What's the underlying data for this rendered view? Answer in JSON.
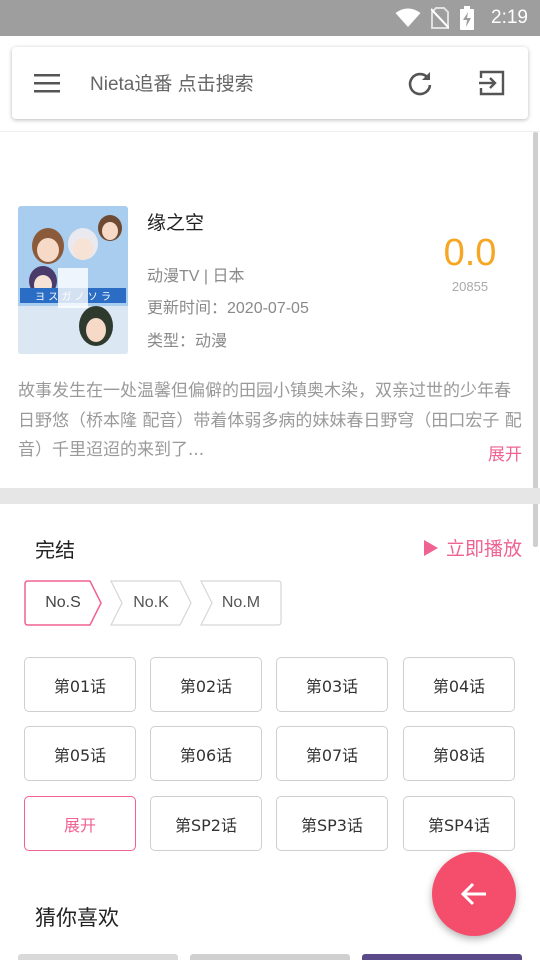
{
  "status_bar": {
    "time": "2:19",
    "icons": [
      "wifi-icon",
      "no-sim-icon",
      "battery-charging-icon"
    ]
  },
  "search": {
    "placeholder": "Nieta追番  点击搜索",
    "icons": [
      "menu-icon",
      "refresh-icon",
      "exit-icon"
    ]
  },
  "anime": {
    "title": "缘之空",
    "category": "动漫TV | 日本",
    "updated": "更新时间：2020-07-05",
    "type": "类型：动漫",
    "score": "0.0",
    "votes": "20855",
    "description": "故事发生在一处温馨但偏僻的田园小镇奥木染，双亲过世的少年春日野悠（桥本隆 配音）带着体弱多病的妹妹春日野穹（田口宏子 配音）千里迢迢的来到了...",
    "expand_label": "展开"
  },
  "episodes_section": {
    "status": "完结",
    "play_label": "立即播放",
    "sources": [
      "No.S",
      "No.K",
      "No.M"
    ],
    "selected_source": "No.S",
    "episodes": [
      "第01话",
      "第02话",
      "第03话",
      "第04话",
      "第05话",
      "第06话",
      "第07话",
      "第08话",
      "展开",
      "第SP2话",
      "第SP3话",
      "第SP4话"
    ]
  },
  "recommend": {
    "title": "猜你喜欢"
  },
  "colors": {
    "accent": "#f06292",
    "score": "#f5a623",
    "fab": "#f44e6c",
    "status_bar": "#9e9e9e"
  }
}
